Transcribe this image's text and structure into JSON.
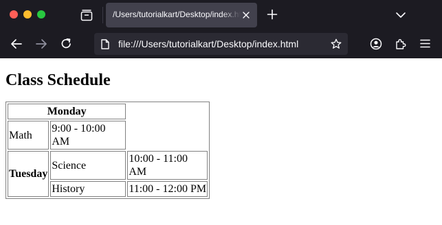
{
  "browser": {
    "tab_title": "/Users/tutorialkart/Desktop/index.html",
    "url": "file:///Users/tutorialkart/Desktop/index.html",
    "colors": {
      "chrome_bg": "#1c1b22",
      "tab_bg": "#42414d",
      "urlbar_bg": "#2b2a33",
      "text": "#fbfbfe"
    }
  },
  "page": {
    "title": "Class Schedule",
    "table": {
      "header": "Monday",
      "rows": [
        {
          "subject": "Math",
          "time": "9:00 - 10:00 AM"
        },
        {
          "day": "Tuesday",
          "subject": "Science",
          "time": "10:00 - 11:00 AM"
        },
        {
          "subject": "History",
          "time": "11:00 - 12:00 PM"
        }
      ]
    }
  }
}
